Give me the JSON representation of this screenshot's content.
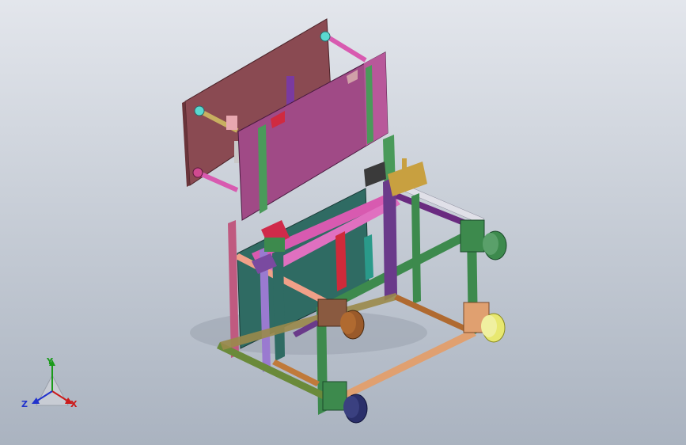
{
  "viewport": {
    "background_top": "#e3e6ec",
    "background_bottom": "#aab3c0"
  },
  "triad": {
    "x_label": "X",
    "y_label": "Y",
    "z_label": "Z",
    "x_color": "#cc1a1a",
    "y_color": "#1a9a1a",
    "z_color": "#2233cc"
  },
  "model": {
    "panel_colors": {
      "back_panel": "#8a4a52",
      "front_panel": "#a04a86",
      "teal_panel": "#2f6b63",
      "frame_green": "#3d8a4d",
      "frame_pink": "#d85ab0",
      "frame_orange": "#e09860",
      "roller_brown": "#9a5a2a",
      "roller_yellow": "#e8e870",
      "roller_navy": "#2a2f6a"
    }
  }
}
